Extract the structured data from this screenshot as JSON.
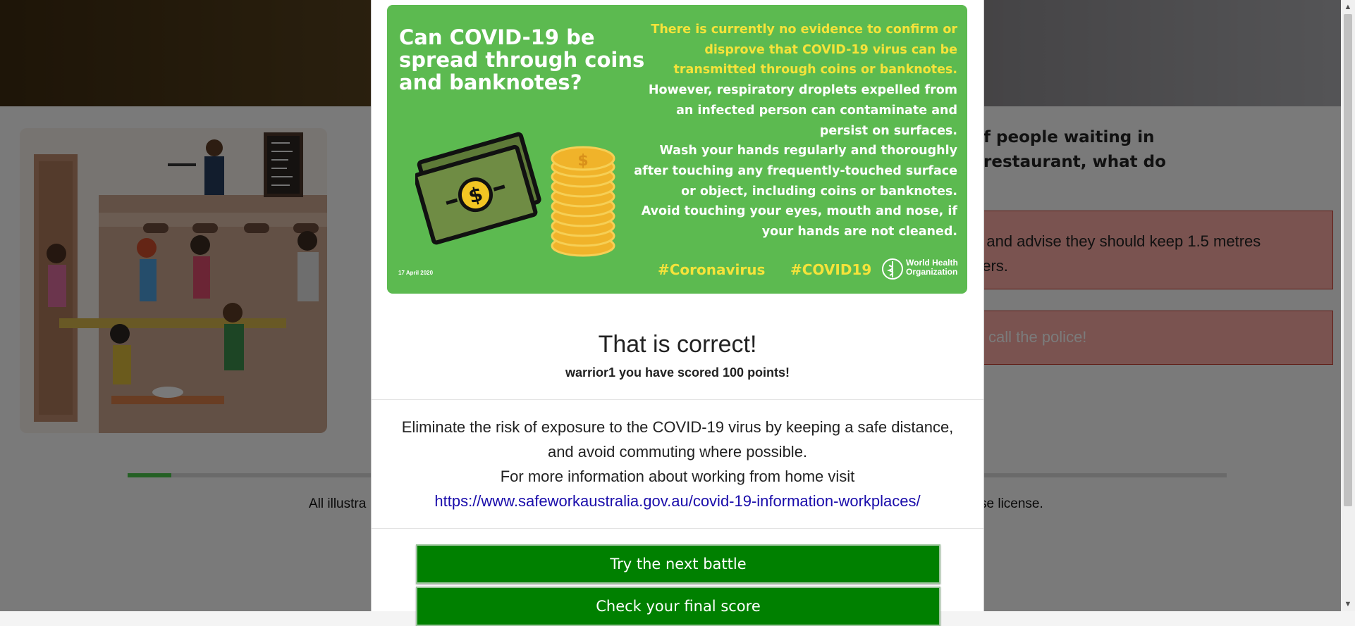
{
  "background": {
    "question": "f people waiting in\nrestaurant, what do",
    "answers": [
      {
        "text": "e and advise they should keep 1.5 metres\nhers."
      },
      {
        "text": "call the police!"
      }
    ],
    "progress": 0.04,
    "footer_left": "All illustra",
    "footer_right": "se license."
  },
  "poster": {
    "question": "Can COVID-19 be spread through coins and banknotes?",
    "info_yellow": "There is currently no evidence to confirm or disprove that COVID-19 virus can be transmitted through coins or banknotes.",
    "info_white_1": "However, respiratory droplets expelled from an infected person can contaminate and persist on surfaces.",
    "info_white_2": "Wash your hands regularly and thoroughly after touching any frequently-touched surface or object, including coins or banknotes.",
    "info_white_3": "Avoid touching your eyes, mouth and nose, if your hands are not cleaned.",
    "date": "17 April 2020",
    "hashtag_1": "#Coronavirus",
    "hashtag_2": "#COVID19",
    "who_line_1": "World Health",
    "who_line_2": "Organization"
  },
  "modal": {
    "title": "That is correct!",
    "score": "warrior1 you have scored 100 points!",
    "body_line_1": "Eliminate the risk of exposure to the COVID-19 virus by keeping a safe distance, and avoid commuting where possible.",
    "body_line_2": "For more information about working from home visit",
    "link": "https://www.safeworkaustralia.gov.au/covid-19-information-workplaces/",
    "next_button": "Try the next battle",
    "final_button": "Check your final score"
  },
  "icons": {
    "scroll_up": "scroll-up-arrow-icon",
    "scroll_down": "scroll-down-arrow-icon",
    "banknote": "banknote-icon",
    "coins": "coin-stack-icon",
    "who": "who-emblem-icon"
  }
}
